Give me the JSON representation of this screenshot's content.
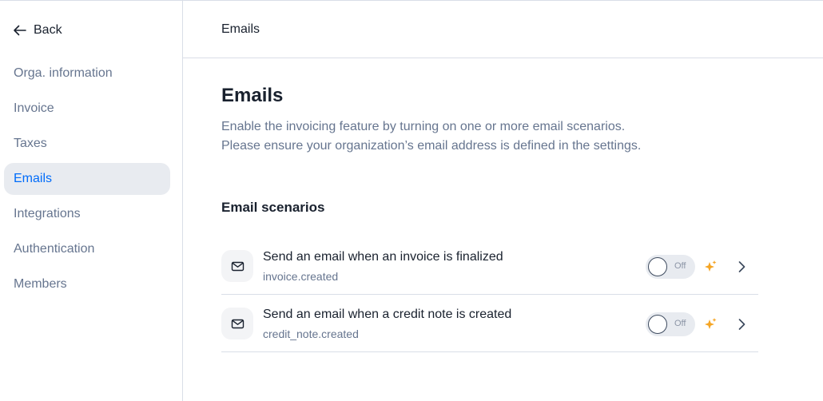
{
  "sidebar": {
    "back_label": "Back",
    "items": [
      {
        "label": "Orga. information",
        "active": false
      },
      {
        "label": "Invoice",
        "active": false
      },
      {
        "label": "Taxes",
        "active": false
      },
      {
        "label": "Emails",
        "active": true
      },
      {
        "label": "Integrations",
        "active": false
      },
      {
        "label": "Authentication",
        "active": false
      },
      {
        "label": "Members",
        "active": false
      }
    ]
  },
  "header": {
    "title": "Emails"
  },
  "main": {
    "title": "Emails",
    "description_line1": "Enable the invoicing feature by turning on one or more email scenarios.",
    "description_line2": "Please ensure your organization’s email address is defined in the settings.",
    "section_title": "Email scenarios",
    "scenarios": [
      {
        "title": "Send an email when an invoice is finalized",
        "event": "invoice.created",
        "toggle_label": "Off",
        "enabled": false
      },
      {
        "title": "Send an email when a credit note is created",
        "event": "credit_note.created",
        "toggle_label": "Off",
        "enabled": false
      }
    ]
  },
  "colors": {
    "accent": "#006cfa",
    "active_bg": "#e8ebf0",
    "muted_text": "#66758f",
    "sparkle": "#f5a524",
    "border": "#d9dee7"
  },
  "icons": {
    "back": "arrow-left-icon",
    "mail": "mail-icon",
    "premium": "sparkles-icon",
    "chevron": "chevron-right-icon"
  }
}
